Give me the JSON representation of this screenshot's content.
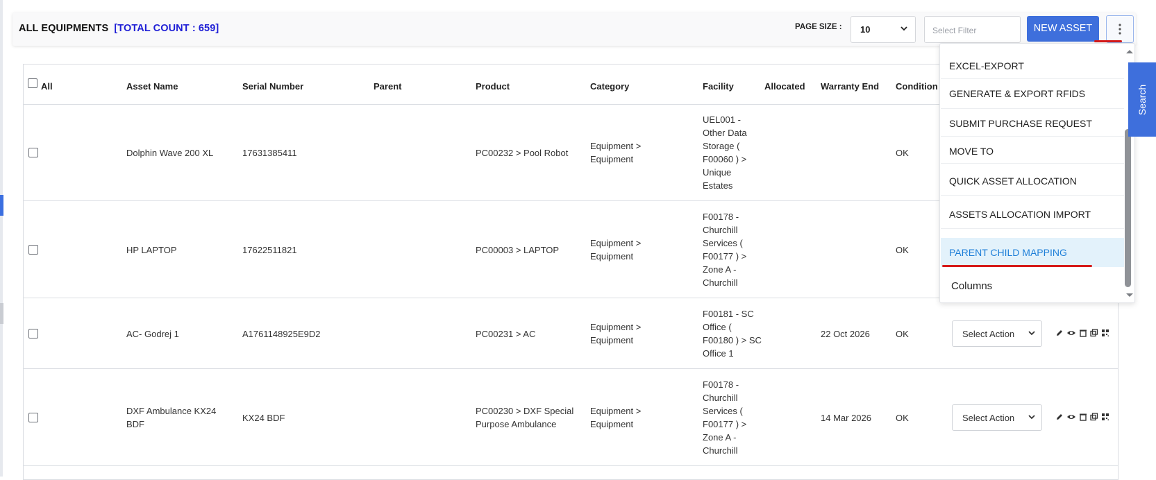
{
  "header": {
    "title": "ALL EQUIPMENTS",
    "total_count": "[TOTAL COUNT : 659]",
    "page_size_label": "PAGE SIZE :",
    "page_size_value": "10",
    "filter_placeholder": "Select Filter",
    "new_asset_label": "NEW ASSET"
  },
  "table": {
    "headers": {
      "all": "All",
      "asset_name": "Asset Name",
      "serial_number": "Serial Number",
      "parent": "Parent",
      "product": "Product",
      "category": "Category",
      "facility": "Facility",
      "allocated": "Allocated",
      "warranty_end": "Warranty End",
      "condition": "Condition"
    },
    "rows": [
      {
        "asset_name": "Dolphin Wave 200 XL",
        "serial_number": "17631385411",
        "product": "PC00232 > Pool Robot",
        "category": "Equipment > Equipment",
        "facility": "UEL001 - Other Data Storage ( F00060 ) > Unique Estates",
        "warranty_end": "",
        "condition": "OK"
      },
      {
        "asset_name": "HP LAPTOP",
        "serial_number": "17622511821",
        "product": "PC00003 > LAPTOP",
        "category": "Equipment > Equipment",
        "facility": "F00178 - Churchill Services ( F00177 ) > Zone A - Churchill",
        "warranty_end": "",
        "condition": "OK"
      },
      {
        "asset_name": "AC- Godrej 1",
        "serial_number": "A1761148925E9D2",
        "product": "PC00231 > AC",
        "category": "Equipment > Equipment",
        "facility": "F00181 - SC Office ( F00180 ) > SC Office 1",
        "warranty_end": "22 Oct 2026",
        "condition": "OK",
        "action": "Select Action"
      },
      {
        "asset_name": "DXF Ambulance KX24 BDF",
        "serial_number": "KX24 BDF",
        "product": "PC00230 > DXF Special Purpose Ambulance",
        "category": "Equipment > Equipment",
        "facility": "F00178 - Churchill Services ( F00177 ) > Zone A - Churchill",
        "warranty_end": "14 Mar 2026",
        "condition": "OK",
        "action": "Select Action"
      }
    ]
  },
  "menu": {
    "items": [
      "EXCEL-EXPORT",
      "GENERATE & EXPORT RFIDS",
      "SUBMIT PURCHASE REQUEST",
      "MOVE TO",
      "QUICK ASSET ALLOCATION",
      "ASSETS ALLOCATION IMPORT",
      "PARENT CHILD MAPPING",
      "Columns"
    ],
    "active_item": "PARENT CHILD MAPPING"
  },
  "side_tab": {
    "label": "Search"
  },
  "colors": {
    "primary": "#3e6fdc",
    "count_blue": "#1f1fd6",
    "active_item_bg": "#e3f2fb",
    "active_item_text": "#1e7fd8",
    "annotation_red": "#d61a1a"
  },
  "icons": [
    "chevron-down-icon",
    "kebab-menu-icon",
    "edit-icon",
    "view-icon",
    "delete-icon",
    "copy-icon",
    "qr-code-icon"
  ]
}
